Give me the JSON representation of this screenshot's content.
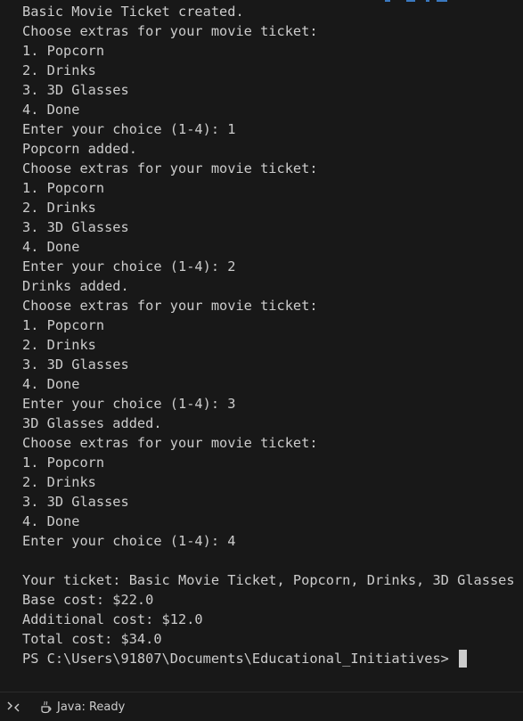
{
  "terminal": {
    "lines": [
      "Basic Movie Ticket created.",
      "Choose extras for your movie ticket:",
      "1. Popcorn",
      "2. Drinks",
      "3. 3D Glasses",
      "4. Done",
      "Enter your choice (1-4): 1",
      "Popcorn added.",
      "Choose extras for your movie ticket:",
      "1. Popcorn",
      "2. Drinks",
      "3. 3D Glasses",
      "4. Done",
      "Enter your choice (1-4): 2",
      "Drinks added.",
      "Choose extras for your movie ticket:",
      "1. Popcorn",
      "2. Drinks",
      "3. 3D Glasses",
      "4. Done",
      "Enter your choice (1-4): 3",
      "3D Glasses added.",
      "Choose extras for your movie ticket:",
      "1. Popcorn",
      "2. Drinks",
      "3. 3D Glasses",
      "4. Done",
      "Enter your choice (1-4): 4",
      "",
      "Your ticket: Basic Movie Ticket, Popcorn, Drinks, 3D Glasses",
      "Base cost: $22.0",
      "Additional cost: $12.0",
      "Total cost: $34.0"
    ],
    "prompt": "PS C:\\Users\\91807\\Documents\\Educational_Initiatives> "
  },
  "statusbar": {
    "remote_icon": "remote-connection-icon",
    "java_icon": "java-icon",
    "java_status": "Java: Ready"
  },
  "colors": {
    "background": "#181818",
    "text": "#cccccc",
    "accent": "#3a79c0"
  }
}
